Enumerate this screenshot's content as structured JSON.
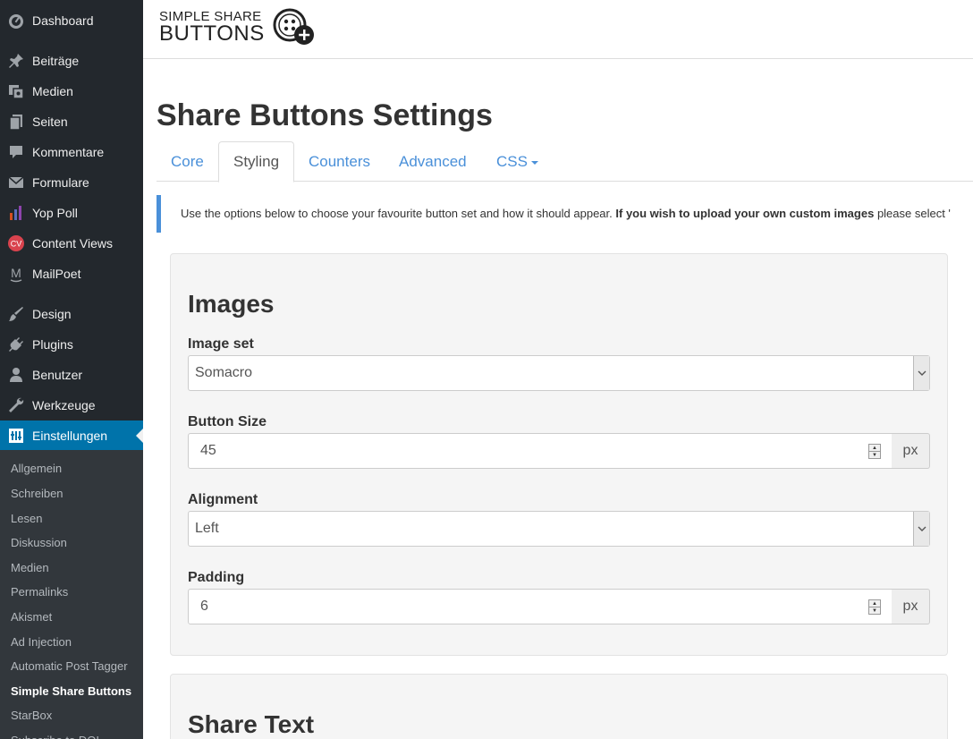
{
  "sidebar": {
    "menu": [
      {
        "label": "Dashboard",
        "icon": "dashboard-icon"
      },
      {
        "label": "Beiträge",
        "icon": "pin-icon"
      },
      {
        "label": "Medien",
        "icon": "media-icon"
      },
      {
        "label": "Seiten",
        "icon": "pages-icon"
      },
      {
        "label": "Kommentare",
        "icon": "comment-icon"
      },
      {
        "label": "Formulare",
        "icon": "mail-icon"
      },
      {
        "label": "Yop Poll",
        "icon": "poll-icon"
      },
      {
        "label": "Content Views",
        "icon": "cv-icon",
        "badge": "CV"
      },
      {
        "label": "MailPoet",
        "icon": "mailpoet-icon",
        "badge": "M"
      },
      {
        "label": "Design",
        "icon": "brush-icon"
      },
      {
        "label": "Plugins",
        "icon": "plugin-icon"
      },
      {
        "label": "Benutzer",
        "icon": "user-icon"
      },
      {
        "label": "Werkzeuge",
        "icon": "wrench-icon"
      },
      {
        "label": "Einstellungen",
        "icon": "settings-icon",
        "active": true
      }
    ],
    "submenu": [
      {
        "label": "Allgemein"
      },
      {
        "label": "Schreiben"
      },
      {
        "label": "Lesen"
      },
      {
        "label": "Diskussion"
      },
      {
        "label": "Medien"
      },
      {
        "label": "Permalinks"
      },
      {
        "label": "Akismet"
      },
      {
        "label": "Ad Injection"
      },
      {
        "label": "Automatic Post Tagger"
      },
      {
        "label": "Simple Share Buttons",
        "current": true
      },
      {
        "label": "StarBox"
      },
      {
        "label": "Subscribe to DOI"
      }
    ]
  },
  "header": {
    "logo_line1": "SIMPLE SHARE",
    "logo_line2": "BUTTONS"
  },
  "page": {
    "title": "Share Buttons Settings",
    "tabs": [
      {
        "label": "Core"
      },
      {
        "label": "Styling",
        "active": true
      },
      {
        "label": "Counters"
      },
      {
        "label": "Advanced"
      },
      {
        "label": "CSS",
        "dropdown": true
      }
    ],
    "notice": {
      "text": "Use the options below to choose your favourite button set and how it should appear.",
      "bold": "If you wish to upload your own custom images",
      "tail": "please select '"
    }
  },
  "images_panel": {
    "title": "Images",
    "image_set": {
      "label": "Image set",
      "value": "Somacro"
    },
    "button_size": {
      "label": "Button Size",
      "value": "45",
      "unit": "px"
    },
    "alignment": {
      "label": "Alignment",
      "value": "Left"
    },
    "padding": {
      "label": "Padding",
      "value": "6",
      "unit": "px"
    }
  },
  "share_text_panel": {
    "title": "Share Text"
  },
  "colors": {
    "sidebar_bg": "#23282d",
    "submenu_bg": "#32373c",
    "active_blue": "#0073aa",
    "link_blue": "#4a90d9"
  }
}
